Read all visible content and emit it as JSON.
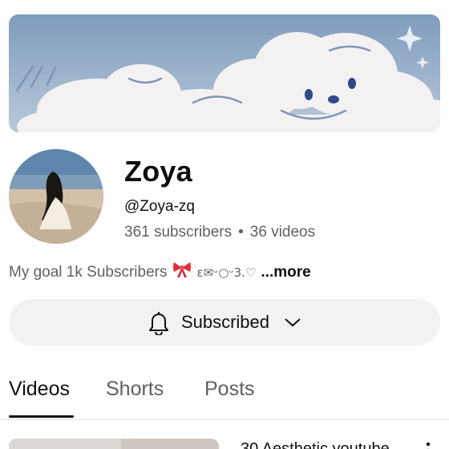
{
  "channel": {
    "name": "Zoya",
    "handle": "@Zoya-zq",
    "subscribers": "361 subscribers",
    "separator": "•",
    "videos": "36 videos",
    "description_text": "My goal 1k Subscribers",
    "description_kaomoji": "ε✉ᵕ○ᵕ3.♡",
    "more_label": "...more"
  },
  "subscribe_button": {
    "label": "Subscribed",
    "icon": "bell-icon",
    "dropdown_icon": "chevron-down-icon"
  },
  "tabs": [
    {
      "label": "Videos",
      "active": true
    },
    {
      "label": "Shorts",
      "active": false
    },
    {
      "label": "Posts",
      "active": false
    }
  ],
  "first_video": {
    "title": "30 Aesthetic youtube"
  },
  "colors": {
    "banner_sky": "#8fa8c4",
    "subscribe_bg": "#f2f2f2",
    "secondary_text": "#606060",
    "bow_red": "#e0313b"
  }
}
